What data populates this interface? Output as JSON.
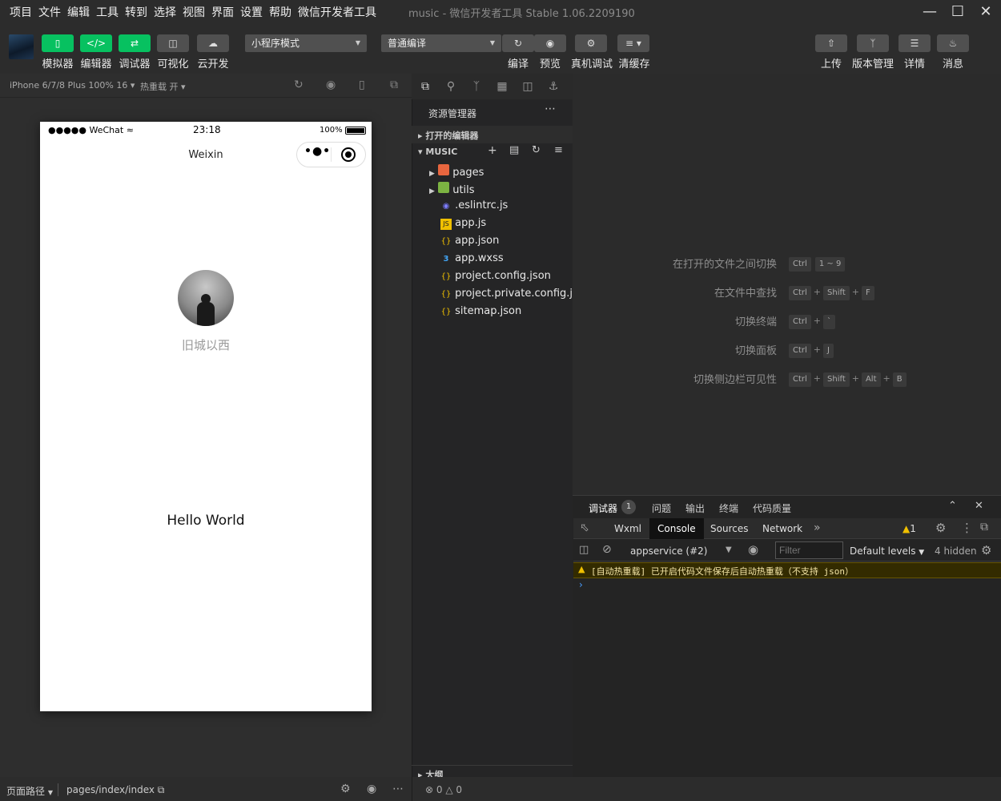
{
  "menu": [
    "项目",
    "文件",
    "编辑",
    "工具",
    "转到",
    "选择",
    "视图",
    "界面",
    "设置",
    "帮助",
    "微信开发者工具"
  ],
  "window": {
    "title": "music - 微信开发者工具 Stable 1.06.2209190"
  },
  "toolbar": {
    "left_buttons": [
      "模拟器",
      "编辑器",
      "调试器",
      "可视化",
      "云开发"
    ],
    "mode_select": "小程序模式",
    "compile_select": "普通编译",
    "center_buttons": [
      "编译",
      "预览",
      "真机调试",
      "清缓存"
    ],
    "right_buttons": [
      "上传",
      "版本管理",
      "详情",
      "消息"
    ]
  },
  "simulator": {
    "device": "iPhone 6/7/8 Plus 100% 16",
    "hot_reload": "热重载 开",
    "status": {
      "signal": "●●●●● WeChat",
      "time": "23:18",
      "battery": "100%"
    },
    "nav_title": "Weixin",
    "username": "旧城以西",
    "content": "Hello World"
  },
  "explorer": {
    "title": "资源管理器",
    "open_editors": "打开的编辑器",
    "project": "MUSIC",
    "files": [
      {
        "name": "pages",
        "type": "folder"
      },
      {
        "name": "utils",
        "type": "folder"
      },
      {
        "name": ".eslintrc.js",
        "type": "eslint"
      },
      {
        "name": "app.js",
        "type": "js"
      },
      {
        "name": "app.json",
        "type": "json"
      },
      {
        "name": "app.wxss",
        "type": "css"
      },
      {
        "name": "project.config.json",
        "type": "json"
      },
      {
        "name": "project.private.config.js...",
        "type": "json"
      },
      {
        "name": "sitemap.json",
        "type": "json"
      }
    ],
    "outline": "大纲"
  },
  "shortcuts": [
    {
      "label": "在打开的文件之间切换",
      "keys": [
        "Ctrl",
        "1 ~ 9"
      ],
      "sep": ""
    },
    {
      "label": "在文件中查找",
      "keys": [
        "Ctrl",
        "Shift",
        "F"
      ],
      "sep": "+"
    },
    {
      "label": "切换终端",
      "keys": [
        "Ctrl",
        "`"
      ],
      "sep": "+"
    },
    {
      "label": "切换面板",
      "keys": [
        "Ctrl",
        "J"
      ],
      "sep": "+"
    },
    {
      "label": "切换侧边栏可见性",
      "keys": [
        "Ctrl",
        "Shift",
        "Alt",
        "B"
      ],
      "sep": "+"
    }
  ],
  "debugger": {
    "tabs": [
      "调试器",
      "问题",
      "输出",
      "终端",
      "代码质量"
    ],
    "badge": "1",
    "devtools_tabs": [
      "Wxml",
      "Console",
      "Sources",
      "Network"
    ],
    "warning_count": "1",
    "context": "appservice (#2)",
    "filter_placeholder": "Filter",
    "levels": "Default levels",
    "hidden": "4 hidden",
    "message": "[自动热重载] 已开启代码文件保存后自动热重载（不支持 json）"
  },
  "statusbar": {
    "page_path_label": "页面路径",
    "page_path": "pages/index/index",
    "errors": "0",
    "warnings": "0"
  },
  "colors": {
    "accent": "#07c160",
    "warning": "#f0c000"
  }
}
